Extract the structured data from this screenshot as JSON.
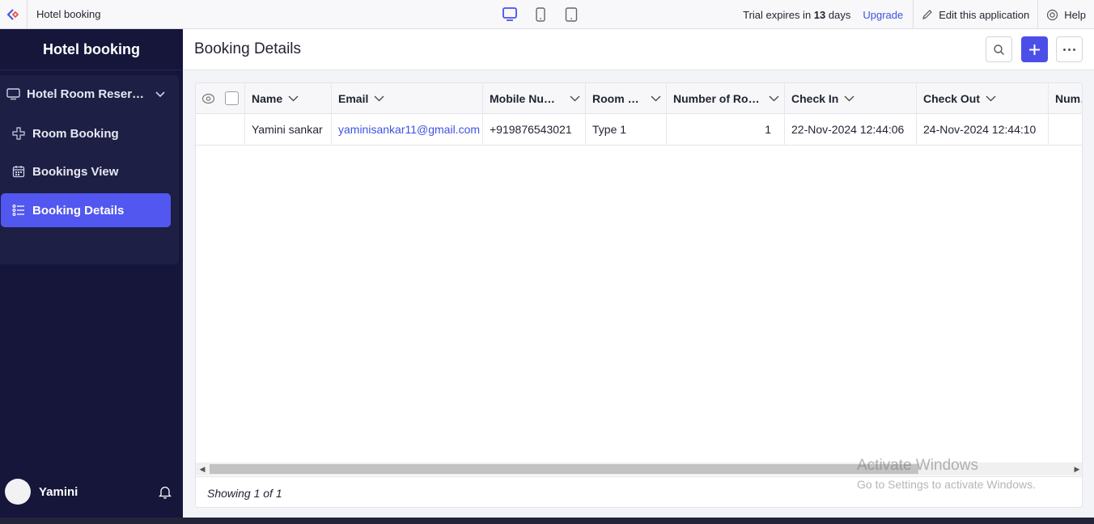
{
  "topbar": {
    "app_name": "Hotel booking",
    "trial_prefix": "Trial expires in",
    "trial_days": "13",
    "trial_suffix": "days",
    "upgrade": "Upgrade",
    "edit_app": "Edit this application",
    "help": "Help",
    "active_device": "desktop"
  },
  "sidebar": {
    "title": "Hotel booking",
    "section": "Hotel Room Reservation",
    "items": [
      {
        "label": "Room Booking",
        "icon": "plus-icon"
      },
      {
        "label": "Bookings View",
        "icon": "calendar-icon"
      },
      {
        "label": "Booking Details",
        "icon": "list-icon",
        "active": true
      }
    ],
    "user": "Yamini"
  },
  "main": {
    "title": "Booking Details",
    "table": {
      "columns": [
        "Name",
        "Email",
        "Mobile Number",
        "Room Type",
        "Number of Rooms",
        "Check In",
        "Check Out",
        "Number"
      ],
      "rows": [
        {
          "name": "Yamini sankar",
          "email": "yaminisankar11@gmail.com",
          "mobile": "+919876543021",
          "room_type": "Type 1",
          "rooms": "1",
          "check_in": "22-Nov-2024 12:44:06",
          "check_out": "24-Nov-2024 12:44:10"
        }
      ]
    },
    "footer": "Showing 1 of 1"
  },
  "watermark": {
    "line1": "Activate Windows",
    "line2": "Go to Settings to activate Windows."
  },
  "colors": {
    "accent": "#4b4fe8",
    "sidebar_bg": "#15163a",
    "link": "#3f51e0"
  }
}
